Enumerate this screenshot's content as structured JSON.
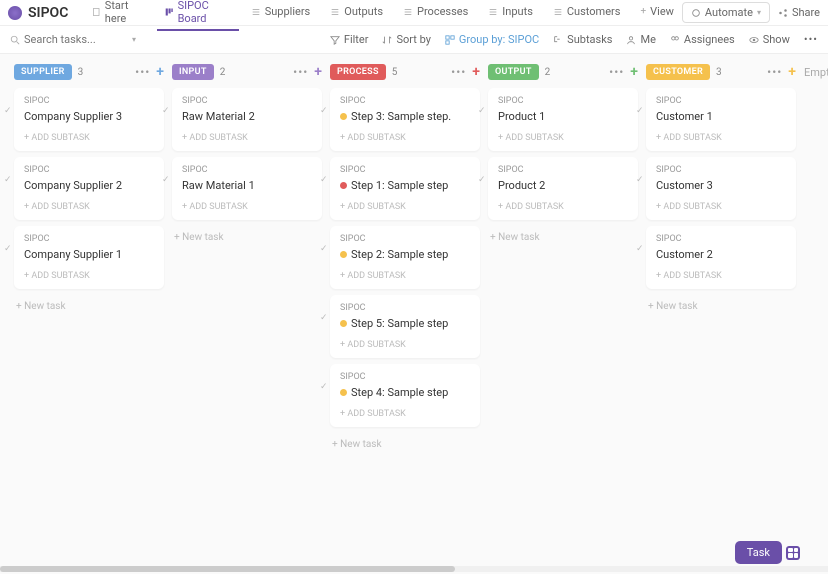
{
  "header": {
    "app_title": "SIPOC",
    "tabs": [
      {
        "label": "Start here"
      },
      {
        "label": "SIPOC Board"
      },
      {
        "label": "Suppliers"
      },
      {
        "label": "Outputs"
      },
      {
        "label": "Processes"
      },
      {
        "label": "Inputs"
      },
      {
        "label": "Customers"
      },
      {
        "label": "View"
      }
    ],
    "automate": "Automate",
    "share": "Share"
  },
  "toolbar": {
    "search_placeholder": "Search tasks...",
    "filter": "Filter",
    "sort": "Sort by",
    "group": "Group by: SIPOC",
    "subtasks": "Subtasks",
    "me": "Me",
    "assignees": "Assignees",
    "show": "Show"
  },
  "columns": [
    {
      "label": "SUPPLIER",
      "color": "#6fa8e0",
      "add_color": "#6fa8e0",
      "count": "3",
      "cards": [
        {
          "tag": "SIPOC",
          "title": "Company Supplier 3",
          "dot": null
        },
        {
          "tag": "SIPOC",
          "title": "Company Supplier 2",
          "dot": null
        },
        {
          "tag": "SIPOC",
          "title": "Company Supplier 1",
          "dot": null
        }
      ]
    },
    {
      "label": "INPUT",
      "color": "#9b7fc9",
      "add_color": "#9b7fc9",
      "count": "2",
      "cards": [
        {
          "tag": "SIPOC",
          "title": "Raw Material 2",
          "dot": null
        },
        {
          "tag": "SIPOC",
          "title": "Raw Material 1",
          "dot": null
        }
      ]
    },
    {
      "label": "PROCESS",
      "color": "#e05b5b",
      "add_color": "#e05b5b",
      "count": "5",
      "cards": [
        {
          "tag": "SIPOC",
          "title": "Step 3: Sample step.",
          "dot": "#f5c14d"
        },
        {
          "tag": "SIPOC",
          "title": "Step 1: Sample step",
          "dot": "#e05b5b"
        },
        {
          "tag": "SIPOC",
          "title": "Step 2: Sample step",
          "dot": "#f5c14d"
        },
        {
          "tag": "SIPOC",
          "title": "Step 5: Sample step",
          "dot": "#f5c14d"
        },
        {
          "tag": "SIPOC",
          "title": "Step 4: Sample step",
          "dot": "#f5c14d"
        }
      ]
    },
    {
      "label": "OUTPUT",
      "color": "#6fbf73",
      "add_color": "#6fbf73",
      "count": "2",
      "cards": [
        {
          "tag": "SIPOC",
          "title": "Product 1",
          "dot": null
        },
        {
          "tag": "SIPOC",
          "title": "Product 2",
          "dot": null
        }
      ]
    },
    {
      "label": "CUSTOMER",
      "color": "#f5c14d",
      "add_color": "#f5c14d",
      "count": "3",
      "cards": [
        {
          "tag": "SIPOC",
          "title": "Customer 1",
          "dot": null
        },
        {
          "tag": "SIPOC",
          "title": "Customer 3",
          "dot": null
        },
        {
          "tag": "SIPOC",
          "title": "Customer 2",
          "dot": null
        }
      ]
    }
  ],
  "empty_label": "Empty",
  "add_subtask": "+ ADD SUBTASK",
  "new_task": "+ New task",
  "fab_task": "Task"
}
